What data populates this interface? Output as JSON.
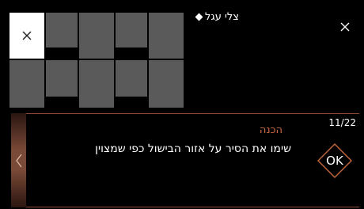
{
  "header": {
    "recipe_title": "צלי עגל"
  },
  "step": {
    "title": "הכנה",
    "instruction": "שימו את הסיר על אזור הבישול כפי שמצוין",
    "counter": "11/22",
    "ok_label": "OK"
  },
  "colors": {
    "accent": "#c56a3e",
    "tile": "#5a5a5a",
    "tile_active": "#ffffff",
    "background": "#000000"
  },
  "icons": {
    "tile_close": "close-icon",
    "main_close": "close-icon",
    "prev": "chevron-left-icon",
    "title_marker": "diamond-icon"
  }
}
